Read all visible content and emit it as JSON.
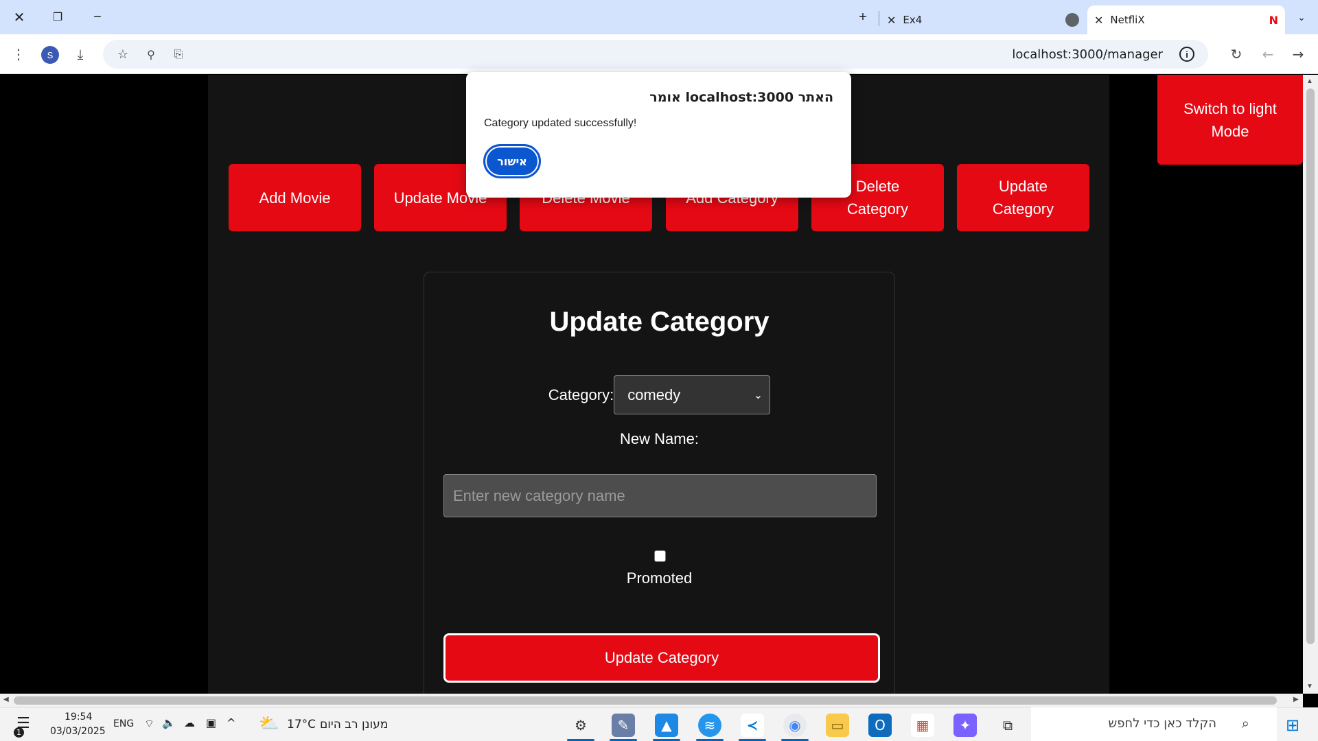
{
  "browser": {
    "tabs": [
      {
        "label": "NetfliX",
        "active": true
      },
      {
        "label": "Ex4",
        "active": false
      }
    ],
    "url": "localhost:3000/manager",
    "profile_initial": "S",
    "new_tab_glyph": "+",
    "icons": [
      "close-icon",
      "restore-icon",
      "minimize-icon",
      "menu-icon",
      "download-icon",
      "star-icon",
      "zoom-icon",
      "translate-icon",
      "reload-icon",
      "back-icon",
      "forward-icon",
      "info-icon"
    ]
  },
  "page": {
    "theme_button": "Switch to light Mode",
    "nav_buttons": [
      "Add Movie",
      "Update Movie",
      "Delete Movie",
      "Add Category",
      "Delete Category",
      "Update Category"
    ],
    "form": {
      "title": "Update Category",
      "category_label": "Category:",
      "category_value": "comedy",
      "new_name_label": "New Name:",
      "new_name_placeholder": "Enter new category name",
      "promoted_label": "Promoted",
      "promoted_checked": false,
      "submit_label": "Update Category"
    },
    "colors": {
      "accent": "#e50914",
      "background": "#141414"
    }
  },
  "dialog": {
    "title": "האתר localhost:3000 אומר",
    "message": "Category updated successfully!",
    "ok_label": "אישור"
  },
  "taskbar": {
    "search_placeholder": "הקלד כאן כדי לחפש",
    "weather_temp": "17°C",
    "weather_text": "מעונן רב היום",
    "language": "ENG",
    "time": "19:54",
    "date": "03/03/2025",
    "notification_count": "1"
  }
}
